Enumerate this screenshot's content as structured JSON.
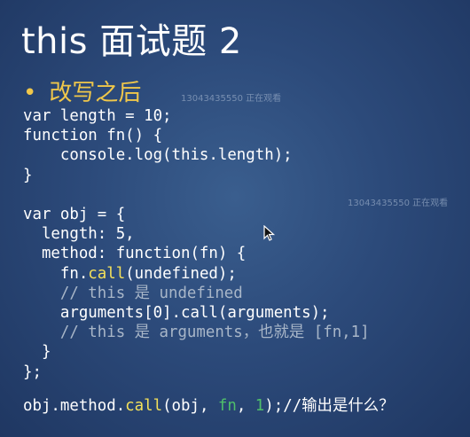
{
  "slide": {
    "title": "this 面试题 2",
    "bullet_text": "改写之后",
    "watermark_top": "13043435550 正在观看",
    "watermark_mid": "13043435550 正在观看"
  },
  "code": {
    "l1": "var length = 10;",
    "l2": "function fn() {",
    "l3": "    console.log(this.length);",
    "l4": "}",
    "l5": "",
    "l6": "var obj = {",
    "l7": "  length: 5,",
    "l8": "  method: function(fn) {",
    "l9_a": "    fn.",
    "l9_call": "call",
    "l9_b": "(undefined);",
    "l10": "    // this 是 undefined",
    "l11": "    arguments[0].call(arguments);",
    "l12": "    // this 是 arguments，也就是 [fn,1]",
    "l13": "  }",
    "l14": "};"
  },
  "question": {
    "a": "obj.method.",
    "call": "call",
    "b": "(obj, ",
    "fn": "fn",
    "c": ", ",
    "one": "1",
    "d": ");//输出是什么？"
  },
  "colors": {
    "title": "#ffffff",
    "bullet": "#f0c74a",
    "call_highlight": "#f3e05a",
    "arg_highlight": "#4fbf6a",
    "comment": "#a8b6c8"
  }
}
